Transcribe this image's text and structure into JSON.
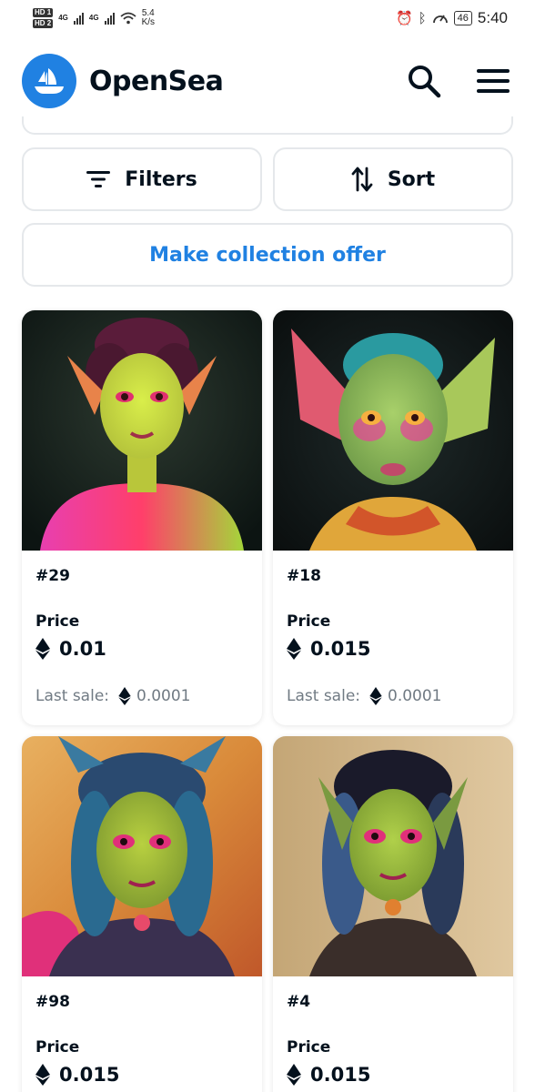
{
  "status_bar": {
    "hd1": "HD 1",
    "hd2": "HD 2",
    "net1": "4G",
    "net2": "4G",
    "speed_value": "5.4",
    "speed_unit": "K/s",
    "battery": "46",
    "time": "5:40"
  },
  "header": {
    "brand": "OpenSea",
    "brand_color": "#2081e2"
  },
  "actions": {
    "filters_label": "Filters",
    "sort_label": "Sort",
    "offer_label": "Make collection offer"
  },
  "items": [
    {
      "name": "#29",
      "price_label": "Price",
      "price": "0.01",
      "last_sale_label": "Last sale:",
      "last_sale": "0.0001"
    },
    {
      "name": "#18",
      "price_label": "Price",
      "price": "0.015",
      "last_sale_label": "Last sale:",
      "last_sale": "0.0001"
    },
    {
      "name": "#98",
      "price_label": "Price",
      "price": "0.015"
    },
    {
      "name": "#4",
      "price_label": "Price",
      "price": "0.015"
    }
  ]
}
